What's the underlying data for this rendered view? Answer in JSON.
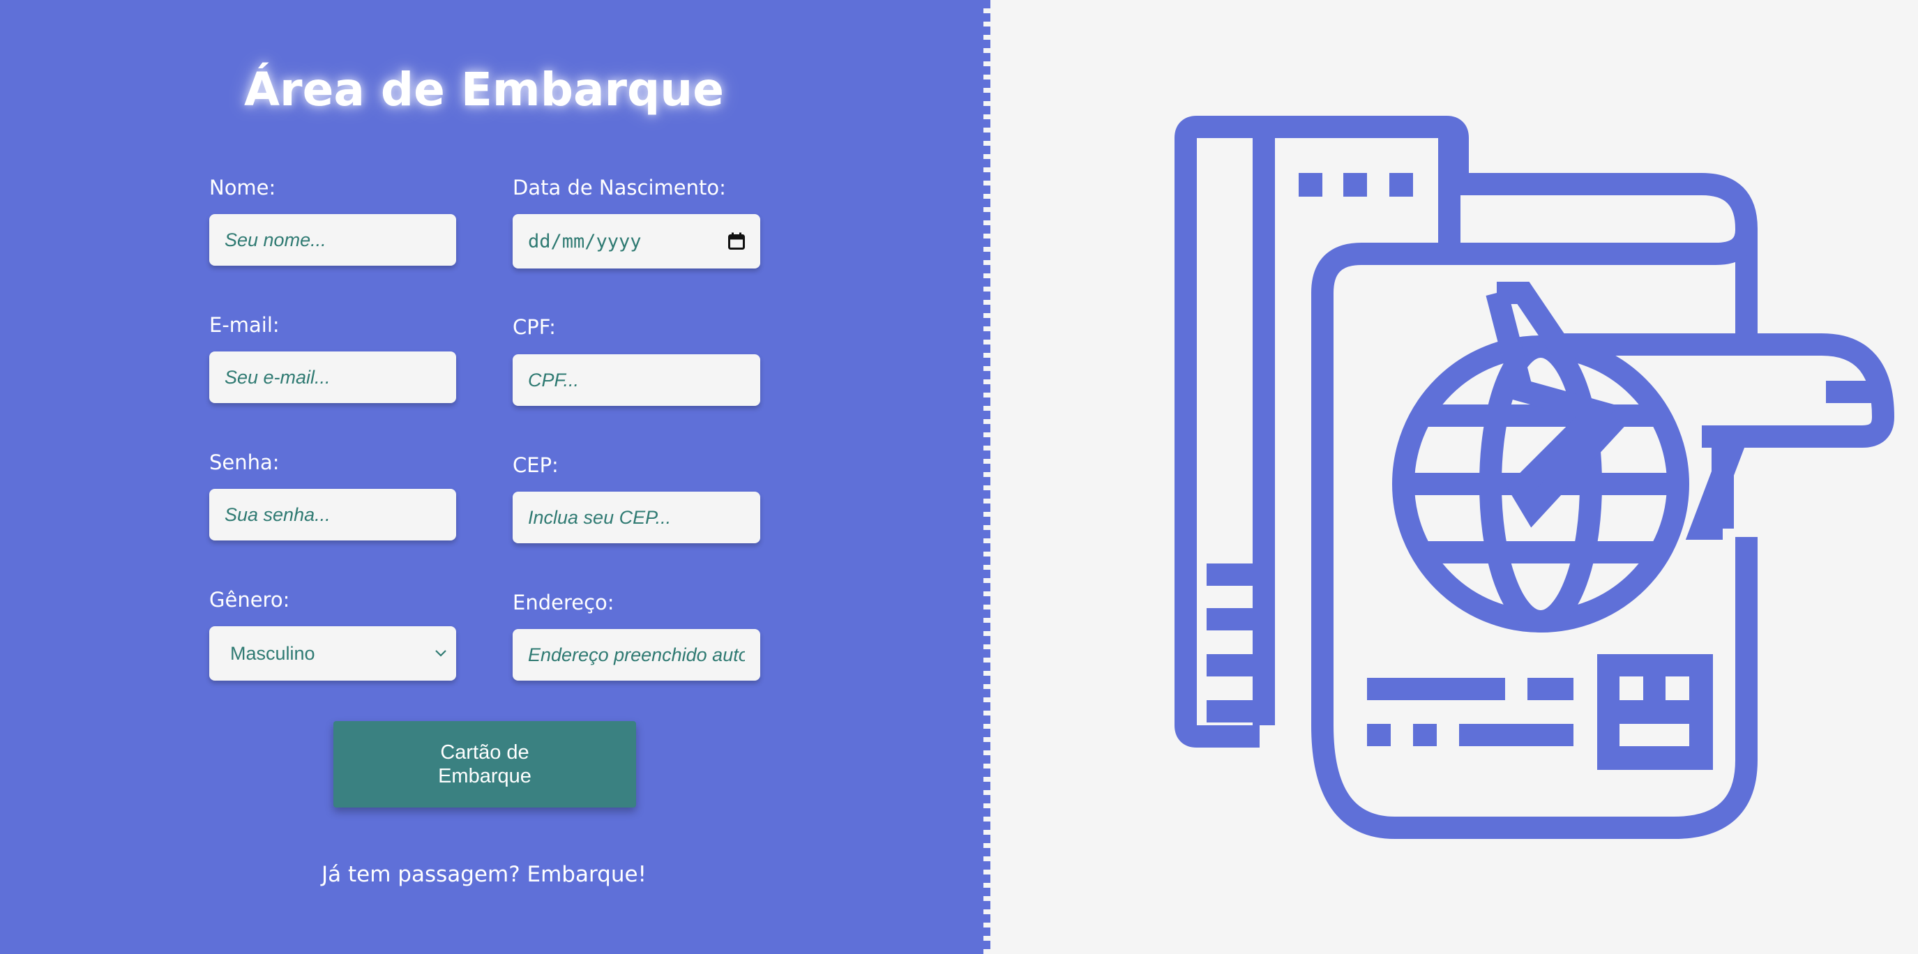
{
  "form": {
    "title": "Área de Embarque",
    "fields": {
      "nome": {
        "label": "Nome:",
        "placeholder": "Seu nome..."
      },
      "nascimento": {
        "label": "Data de Nascimento:",
        "value": "dd/mm/yyyy"
      },
      "email": {
        "label": "E-mail:",
        "placeholder": "Seu e-mail..."
      },
      "cpf": {
        "label": "CPF:",
        "placeholder": "CPF..."
      },
      "senha": {
        "label": "Senha:",
        "placeholder": "Sua senha..."
      },
      "cep": {
        "label": "CEP:",
        "placeholder": "Inclua seu CEP..."
      },
      "genero": {
        "label": "Gênero:",
        "value": "Masculino"
      },
      "endereco": {
        "label": "Endereço:",
        "placeholder": "Endereço preenchido auto"
      }
    },
    "submit_label": "Cartão de Embarque",
    "login_link": "Já tem passagem? Embarque!"
  },
  "icons": {
    "date": "calendar-icon",
    "select": "chevron-down-icon",
    "illustration": "passport-globe-airplane-icon"
  },
  "colors": {
    "panel": "#5f70d8",
    "background": "#f5f5f5",
    "button": "#3a8181",
    "input_text": "#2f7a72",
    "text": "#ffffff"
  }
}
